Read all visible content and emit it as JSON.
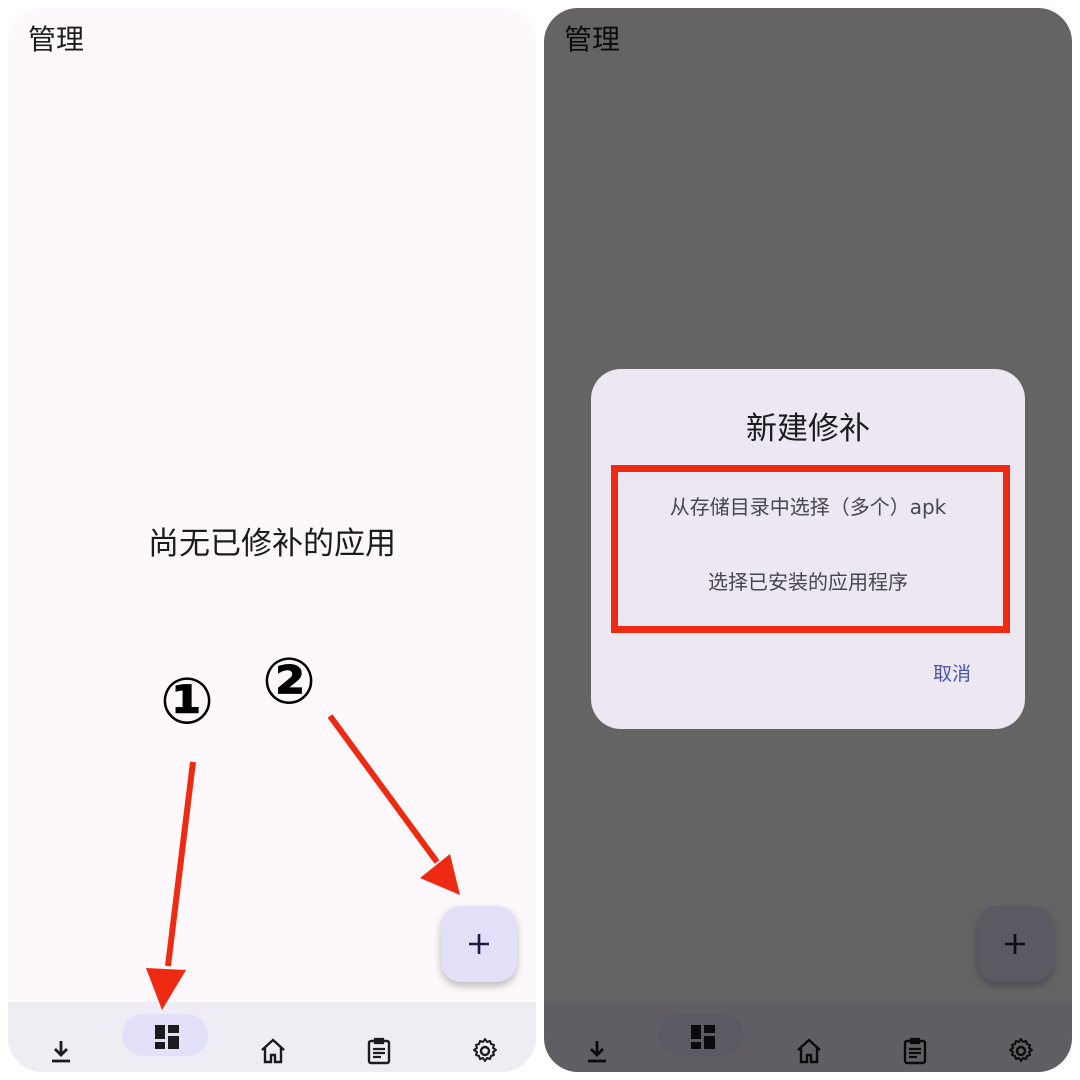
{
  "left_panel": {
    "title": "管理",
    "empty_message": "尚无已修补的应用",
    "annotations": {
      "step1": "①",
      "step2": "②"
    }
  },
  "right_panel": {
    "title": "管理",
    "dialog": {
      "title": "新建修补",
      "option_storage": "从存储目录中选择（多个）apk",
      "option_installed": "选择已安装的应用程序",
      "cancel": "取消"
    }
  },
  "nav_items": [
    "download-icon",
    "dashboard-icon",
    "home-icon",
    "clipboard-icon",
    "settings-icon"
  ],
  "fab_icon": "plus-icon",
  "colors": {
    "arrow": "#ee2a12",
    "highlight": "#ee2a12",
    "fab": "#e2e0f8",
    "nav_selected": "#e2e0f8"
  }
}
